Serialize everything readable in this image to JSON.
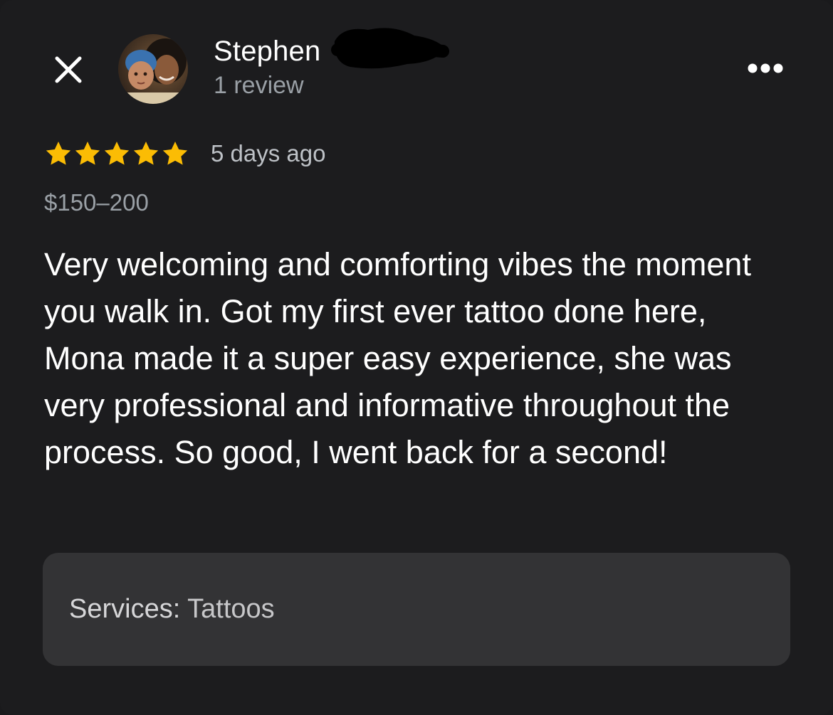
{
  "header": {
    "close_icon": "close-icon",
    "more_icon": "more-horizontal-icon",
    "reviewer_name": "Stephen",
    "review_count": "1 review"
  },
  "review": {
    "rating": 5,
    "rating_max": 5,
    "star_color": "#fbbc04",
    "time_ago": "5 days ago",
    "price": "$150–200",
    "text": "Very welcoming and comforting vibes the moment you walk in. Got my first ever tattoo done here, Mona made it a super easy experience, she was very professional and informative throughout the process. So good, I went back for a second!"
  },
  "services": {
    "label": "Services:",
    "value": "Tattoos"
  }
}
